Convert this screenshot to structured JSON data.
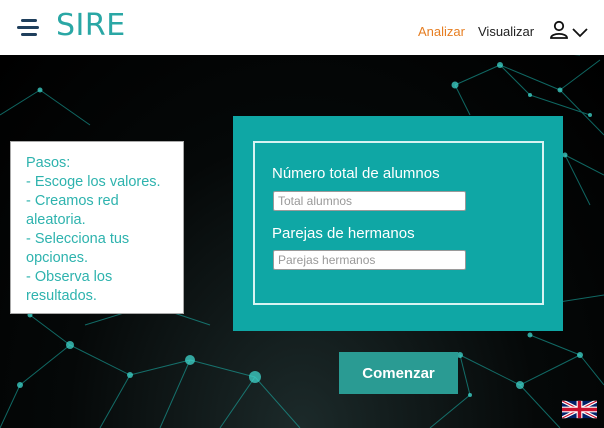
{
  "header": {
    "logo": "SIRE",
    "nav": {
      "analizar": "Analizar",
      "visualizar": "Visualizar"
    },
    "icons": {
      "menu": "hamburger-menu-icon",
      "user": "user-icon",
      "dropdown": "chevron-down-icon"
    }
  },
  "colors": {
    "accent": "#2aa7a5",
    "active_nav": "#e67e22",
    "card": "#0fa7a5",
    "button": "#2a9b93"
  },
  "steps": {
    "lines": [
      "Pasos:",
      "- Escoge los valores.",
      "- Creamos red",
      "aleatoria.",
      "- Selecciona tus",
      "opciones.",
      "- Observa los",
      "resultados."
    ]
  },
  "form": {
    "students": {
      "label": "Número total de alumnos",
      "placeholder": "Total alumnos",
      "value": ""
    },
    "siblings": {
      "label": "Parejas de hermanos",
      "placeholder": "Parejas hermanos",
      "value": ""
    },
    "submit_label": "Comenzar"
  },
  "language": {
    "icon": "uk-flag-icon"
  }
}
